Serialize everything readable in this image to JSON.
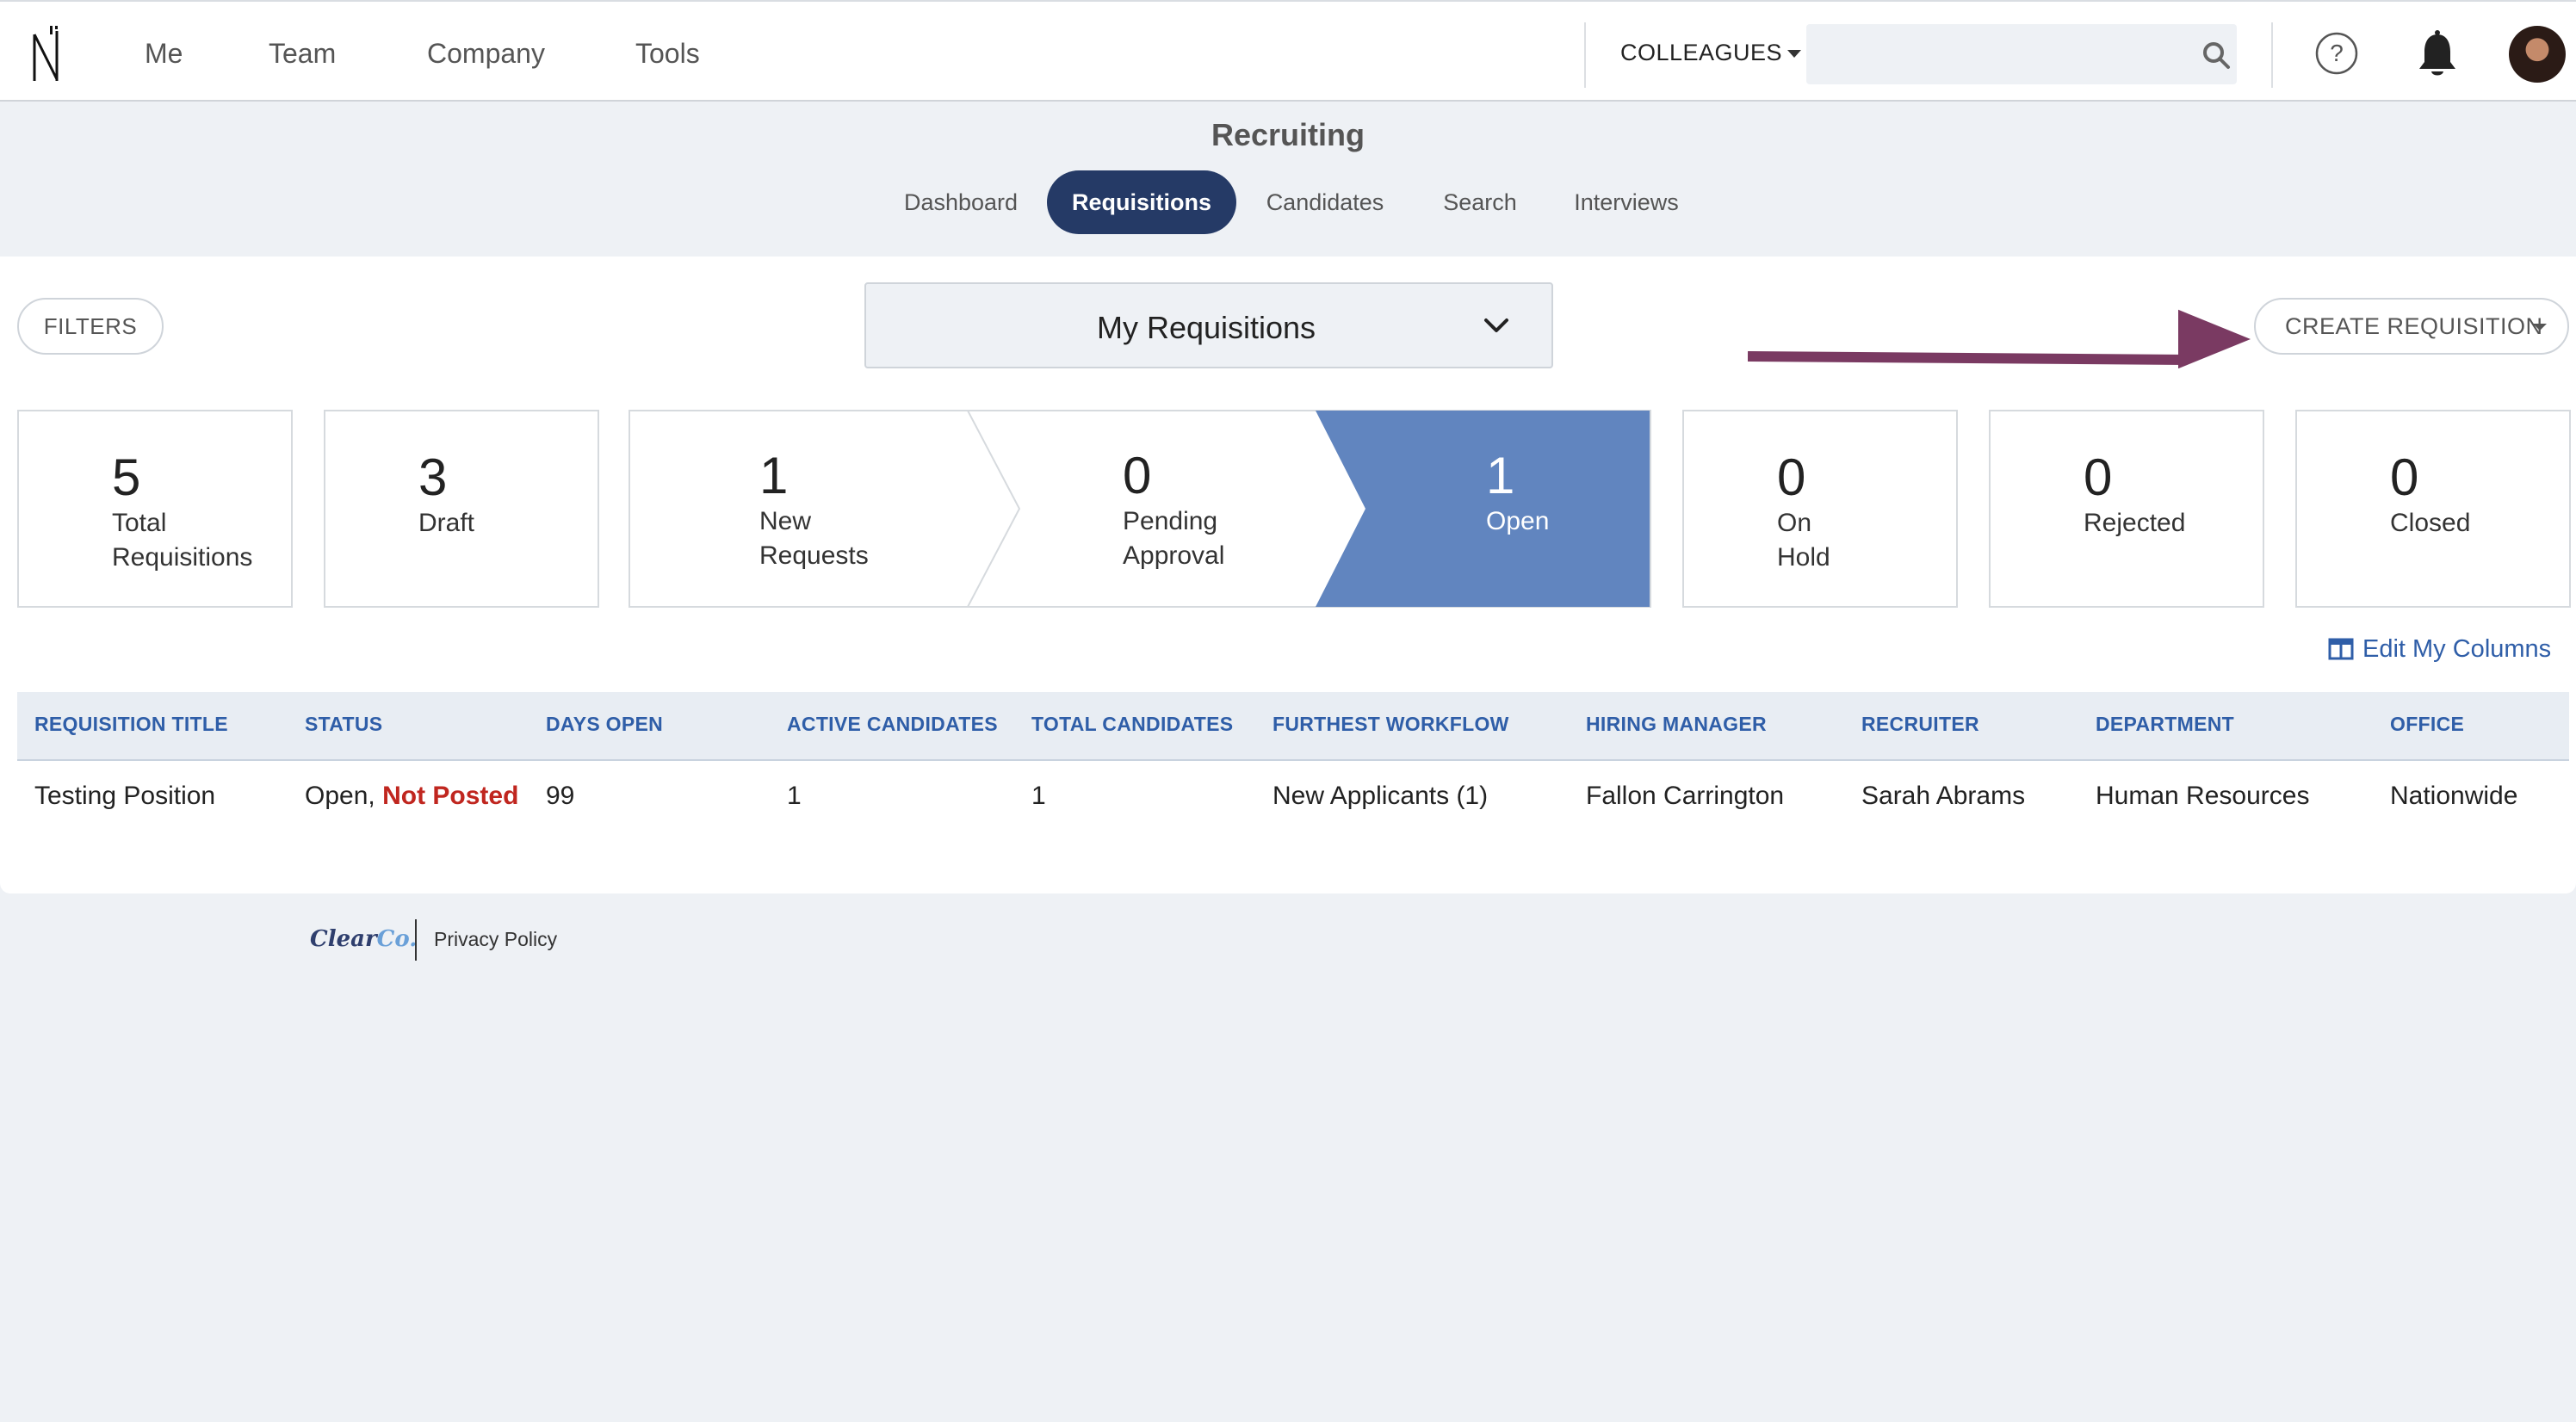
{
  "nav": {
    "links": [
      "Me",
      "Team",
      "Company",
      "Tools"
    ],
    "colleagues_label": "COLLEAGUES",
    "search_placeholder": ""
  },
  "page": {
    "title": "Recruiting",
    "tabs": [
      {
        "label": "Dashboard",
        "active": false
      },
      {
        "label": "Requisitions",
        "active": true
      },
      {
        "label": "Candidates",
        "active": false
      },
      {
        "label": "Search",
        "active": false
      },
      {
        "label": "Interviews",
        "active": false
      }
    ]
  },
  "toolbar": {
    "filters_label": "FILTERS",
    "view_select": "My Requisitions",
    "create_label": "CREATE REQUISITION"
  },
  "stats": [
    {
      "num": "5",
      "label_1": "Total",
      "label_2": "Requisitions"
    },
    {
      "num": "3",
      "label_1": "Draft",
      "label_2": ""
    },
    {
      "num": "1",
      "label_1": "New",
      "label_2": "Requests"
    },
    {
      "num": "0",
      "label_1": "Pending",
      "label_2": "Approval"
    },
    {
      "num": "1",
      "label_1": "Open",
      "label_2": ""
    },
    {
      "num": "0",
      "label_1": "On",
      "label_2": "Hold"
    },
    {
      "num": "0",
      "label_1": "Rejected",
      "label_2": ""
    },
    {
      "num": "0",
      "label_1": "Closed",
      "label_2": ""
    }
  ],
  "edit_columns_label": "Edit My Columns",
  "table": {
    "headers": [
      "REQUISITION TITLE",
      "STATUS",
      "DAYS OPEN",
      "ACTIVE CANDIDATES",
      "TOTAL CANDIDATES",
      "FURTHEST WORKFLOW",
      "HIRING MANAGER",
      "RECRUITER",
      "DEPARTMENT",
      "OFFICE"
    ],
    "rows": [
      {
        "title": "Testing Position",
        "status_prefix": "Open,",
        "status_flag": "Not Posted",
        "days_open": "99",
        "active_candidates": "1",
        "total_candidates": "1",
        "furthest_workflow": "New Applicants (1)",
        "hiring_manager": "Fallon Carrington",
        "recruiter": "Sarah Abrams",
        "department": "Human Resources",
        "office": "Nationwide"
      }
    ]
  },
  "footer": {
    "brand_main": "Clear",
    "brand_accent": "Co.",
    "privacy_label": "Privacy Policy"
  },
  "colors": {
    "accent_navy": "#253a66",
    "link_blue": "#2f5ea8",
    "pipeline_active": "#6185bf",
    "arrow": "#7a3a62",
    "status_red": "#c0261f"
  }
}
